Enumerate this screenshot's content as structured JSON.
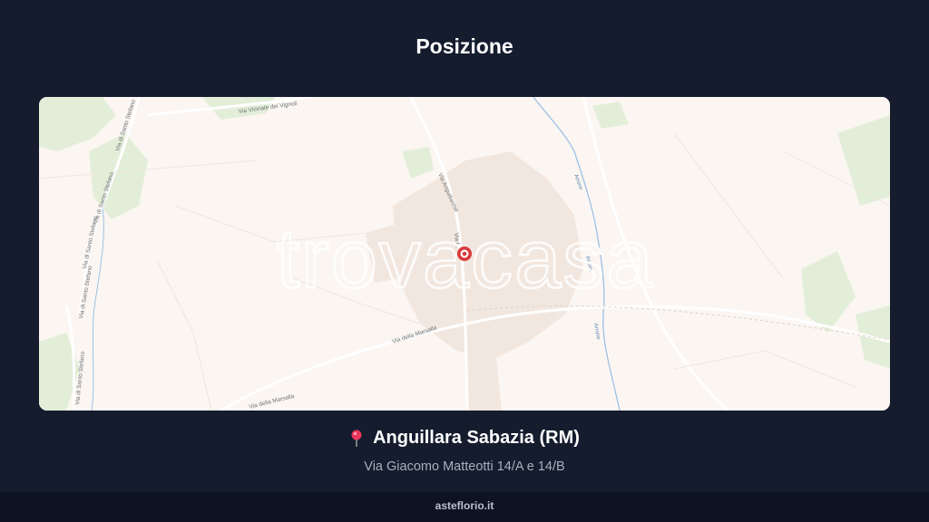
{
  "header": {
    "title": "Posizione"
  },
  "map": {
    "watermark": "trovacasa",
    "street_labels": {
      "vicinale_vignoli": "Via Vicinale dei Vignoli",
      "santo_stefano_1": "Via di Santo Stefano",
      "santo_stefano_2": "Via di Santo Stefano",
      "santo_stefano_3": "Via di Santo Stefano",
      "santo_stefano_4": "Via di Santo Stefano",
      "santo_stefano_5": "Via di Santo Stefano",
      "anguillarese": "Via Anguillarese",
      "via_la": "Via L.",
      "marsala_1": "Via della Marsalla",
      "marsala_2": "Via della Marsalla",
      "arrone_1": "Arrone",
      "arrone_2": "Arrone",
      "arrone_3": "Arrone"
    },
    "colors": {
      "background": "#fbf6f2",
      "green": "#dbe9cf",
      "urban": "#f0e6de",
      "water": "#8fb7df",
      "marker": "#d83a3a"
    }
  },
  "location": {
    "pin_icon": "map-pin-icon",
    "city": "Anguillara Sabazia (RM)",
    "address": "Via Giacomo Matteotti 14/A e 14/B"
  },
  "footer": {
    "site": "asteflorio.it"
  }
}
